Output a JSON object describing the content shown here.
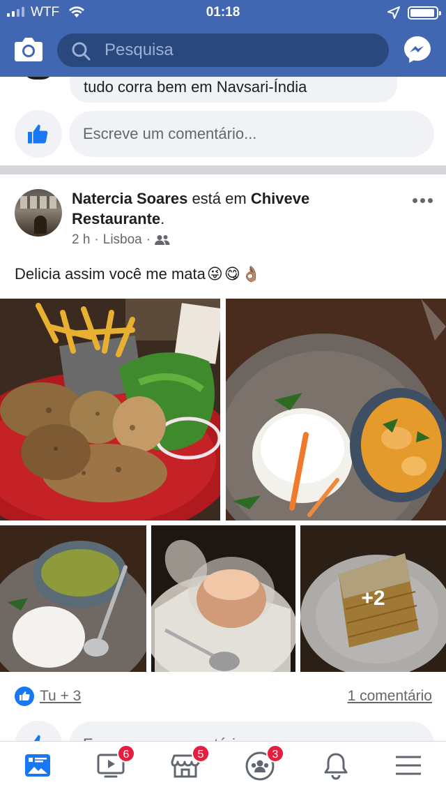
{
  "status_bar": {
    "carrier": "WTF",
    "time": "01:18"
  },
  "header": {
    "search_placeholder": "Pesquisa"
  },
  "previous_post": {
    "comment_text": "tudo corra bem em Navsari-Índia",
    "comment_placeholder": "Escreve um comentário..."
  },
  "post": {
    "author": "Natercia Soares",
    "connector": " está em ",
    "place": "Chiveve Restaurante",
    "place_suffix": ".",
    "time": "2 h",
    "location": "Lisboa",
    "text": "Delicia assim você me mata",
    "emojis": [
      "😜",
      "😋",
      "👌🏽"
    ],
    "photos_more": "+2",
    "reactions_label": "Tu + 3",
    "comments_label": "1 comentário",
    "comment_placeholder": "Escreve um comentário..."
  },
  "tabbar": {
    "badges": {
      "watch": "6",
      "marketplace": "5",
      "groups": "3"
    }
  },
  "colors": {
    "brand": "#4267b2",
    "search_bg": "#29487d",
    "like_blue": "#1877f2",
    "badge_red": "#e41e3f"
  }
}
